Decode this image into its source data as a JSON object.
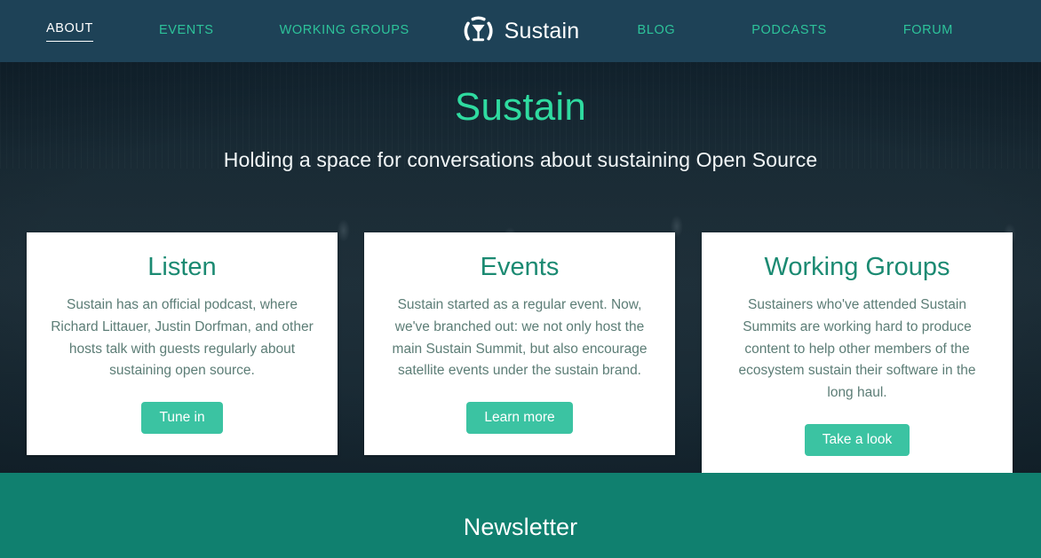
{
  "colors": {
    "navbar_bg": "#1e4257",
    "nav_link": "#2dc39a",
    "nav_link_active": "#ffffff",
    "hero_title": "#2fdba0",
    "card_title": "#1b8a72",
    "card_text": "#5c7d76",
    "button_bg": "#3bc3a2",
    "newsletter_bg": "#10806f"
  },
  "navbar": {
    "left_links": [
      {
        "label": "ABOUT",
        "active": true
      },
      {
        "label": "EVENTS",
        "active": false
      },
      {
        "label": "WORKING GROUPS",
        "active": false
      }
    ],
    "right_links": [
      {
        "label": "BLOG",
        "active": false
      },
      {
        "label": "PODCASTS",
        "active": false
      },
      {
        "label": "FORUM",
        "active": false
      }
    ],
    "brand": {
      "icon": "sustain-chalice-logo-icon",
      "text": "Sustain"
    }
  },
  "hero": {
    "title": "Sustain",
    "subtitle": "Holding a space for conversations about sustaining Open Source",
    "background_image": "crowd-with-raised-hands-photo"
  },
  "cards": [
    {
      "title": "Listen",
      "text": "Sustain has an official podcast, where Richard Littauer, Justin Dorfman, and other hosts talk with guests regularly about sustaining open source.",
      "button_label": "Tune in"
    },
    {
      "title": "Events",
      "text": "Sustain started as a regular event. Now, we've branched out: we not only host the main Sustain Summit, but also encourage satellite events under the sustain brand.",
      "button_label": "Learn more"
    },
    {
      "title": "Working Groups",
      "text": "Sustainers who've attended Sustain Summits are working hard to produce content to help other members of the ecosystem sustain their software in the long haul.",
      "button_label": "Take a look"
    }
  ],
  "newsletter": {
    "title": "Newsletter"
  }
}
